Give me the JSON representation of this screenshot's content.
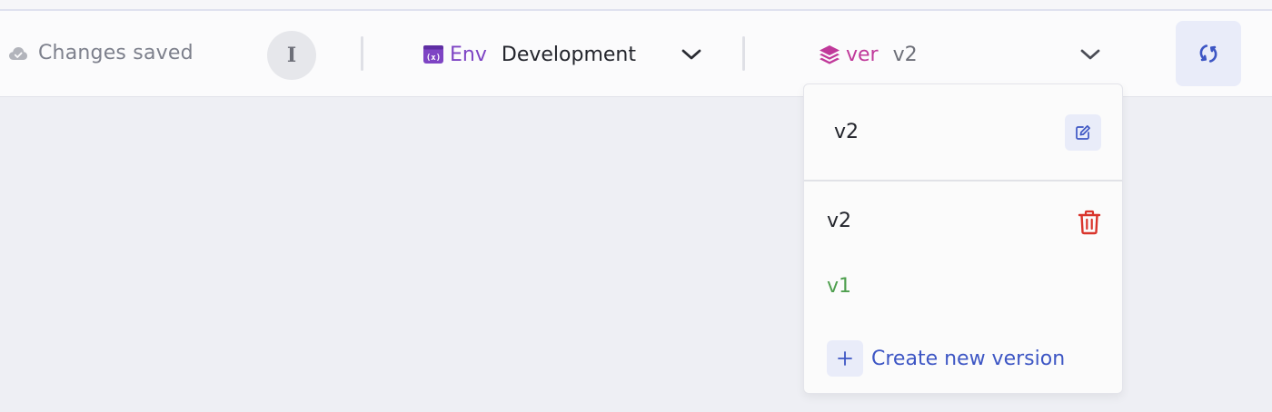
{
  "status": {
    "saved_text": "Changes saved",
    "icon": "cloud-check-icon"
  },
  "user": {
    "avatar_initial": "I"
  },
  "environment": {
    "label": "Env",
    "value": "Development",
    "icon": "variable-icon",
    "accent_color": "#7e44c4"
  },
  "version": {
    "label": "ver",
    "value": "v2",
    "icon": "layers-icon",
    "accent_color": "#c0399a"
  },
  "version_dropdown": {
    "current": "v2",
    "items": [
      {
        "label": "v2",
        "color": "#23252c"
      },
      {
        "label": "v1",
        "color": "#4e9f4e"
      }
    ],
    "create_label": "Create new version"
  },
  "colors": {
    "primary": "#3d56c4",
    "danger": "#d9342b",
    "header_bg": "#fbfbfc",
    "canvas_bg": "#eeeff4"
  }
}
